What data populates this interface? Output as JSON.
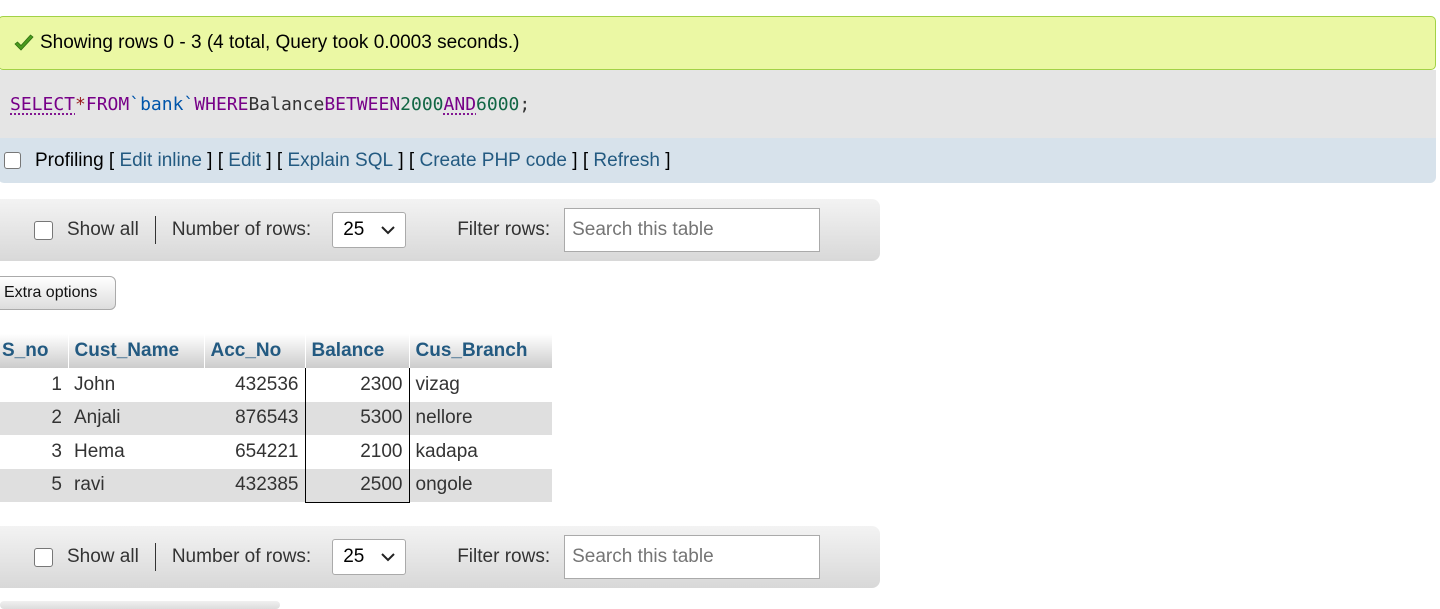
{
  "message": {
    "text": "Showing rows 0 - 3 (4 total, Query took 0.0003 seconds.)",
    "icon": "check-icon",
    "accent": "#a2d246"
  },
  "sql": {
    "select": "SELECT",
    "star": "*",
    "from": "FROM",
    "table": "`bank`",
    "where": "WHERE",
    "field": "Balance",
    "between": "BETWEEN",
    "low": "2000",
    "and": "AND",
    "high": "6000",
    "end": ";"
  },
  "query_toolbar": {
    "profiling_label": "Profiling",
    "edit_inline": "Edit inline",
    "edit": "Edit",
    "explain_sql": "Explain SQL",
    "create_php": "Create PHP code",
    "refresh": "Refresh"
  },
  "nav": {
    "show_all_label": "Show all",
    "rows_label": "Number of rows:",
    "rows_value": "25",
    "filter_label": "Filter rows:",
    "search_placeholder": "Search this table"
  },
  "extra_options_label": "Extra options",
  "table": {
    "columns": [
      "S_no",
      "Cust_Name",
      "Acc_No",
      "Balance",
      "Cus_Branch"
    ],
    "rows": [
      [
        "1",
        "John",
        "432536",
        "2300",
        "vizag"
      ],
      [
        "2",
        "Anjali",
        "876543",
        "5300",
        "nellore"
      ],
      [
        "3",
        "Hema",
        "654221",
        "2100",
        "kadapa"
      ],
      [
        "5",
        "ravi",
        "432385",
        "2500",
        "ongole"
      ]
    ]
  }
}
